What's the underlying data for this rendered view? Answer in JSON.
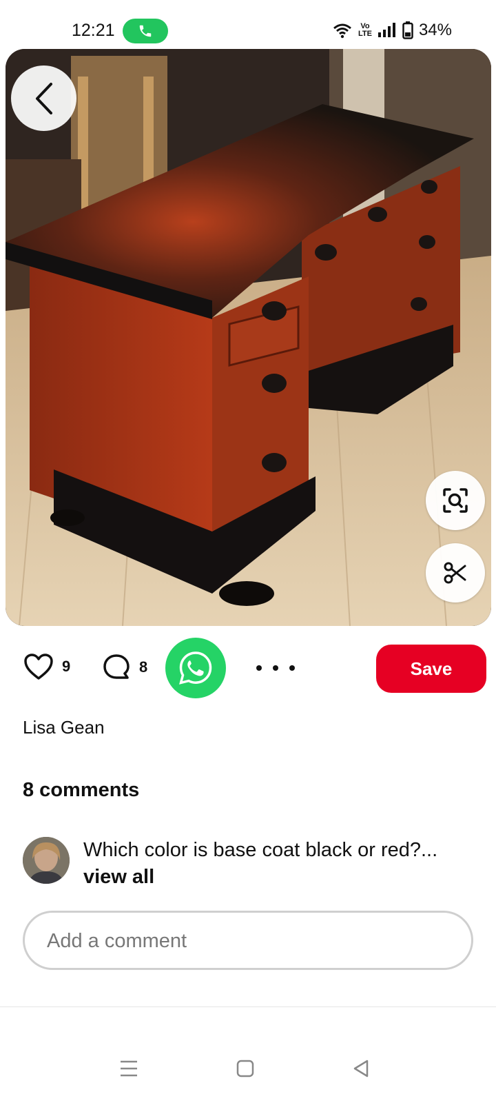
{
  "status_bar": {
    "time": "12:21",
    "call_icon": "phone-icon",
    "volte_top": "Vo",
    "volte_bottom": "LTE",
    "battery": "34%",
    "call_color": "#22c55e"
  },
  "photo": {
    "back_icon": "chevron-left-icon",
    "visual_search_icon": "visual-search-icon",
    "cutout_icon": "scissors-icon"
  },
  "actions": {
    "like_count": "9",
    "comment_count": "8",
    "share_icon": "whatsapp-icon",
    "more_icon": "more-horizontal-icon",
    "save_label": "Save",
    "save_color": "#e60023",
    "whatsapp_color": "#25d366"
  },
  "author": "Lisa Gean",
  "comments": {
    "title": "8 comments",
    "preview_text": "Which color is base coat black or red?...",
    "view_all": "view all",
    "input_placeholder": "Add a comment"
  },
  "navbar": {
    "menu_icon": "menu-icon",
    "home_icon": "square-home-icon",
    "back_icon": "triangle-back-icon"
  }
}
